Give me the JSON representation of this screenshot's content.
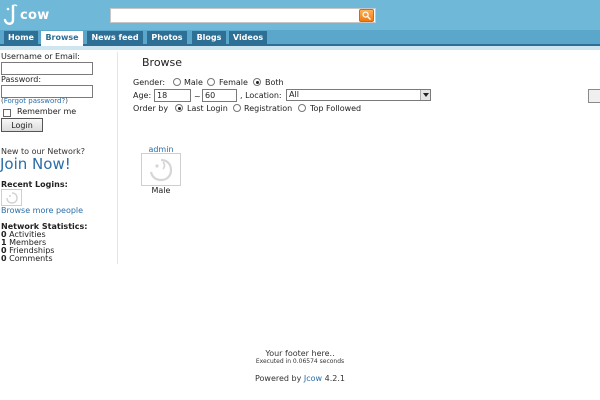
{
  "header": {
    "logo_text": "cow",
    "search": {
      "value": "",
      "placeholder": ""
    }
  },
  "nav": {
    "tabs": [
      {
        "label": "Home",
        "active": false
      },
      {
        "label": "Browse",
        "active": true
      },
      {
        "label": "News feed",
        "active": false
      },
      {
        "label": "Photos",
        "active": false
      },
      {
        "label": "Blogs",
        "active": false
      },
      {
        "label": "Videos",
        "active": false
      }
    ]
  },
  "sidebar": {
    "username_label": "Username or Email:",
    "password_label": "Password:",
    "forgot_prefix": "(",
    "forgot_link": "Forgot password?",
    "forgot_suffix": ")",
    "remember_label": "Remember me",
    "login_button": "Login",
    "new_network": "New to our Network?",
    "join_now": "Join Now!",
    "recent_logins": "Recent Logins:",
    "browse_more": "Browse more people",
    "stats_title": "Network Statistics:",
    "stats": [
      {
        "count": "0",
        "label": "Activities"
      },
      {
        "count": "1",
        "label": "Members"
      },
      {
        "count": "0",
        "label": "Friendships"
      },
      {
        "count": "0",
        "label": "Comments"
      }
    ]
  },
  "main": {
    "title": "Browse",
    "gender_label": "Gender:",
    "gender_options": [
      {
        "label": "Male",
        "checked": false
      },
      {
        "label": "Female",
        "checked": false
      },
      {
        "label": "Both",
        "checked": true
      }
    ],
    "age_label": "Age:",
    "age_from": "18",
    "age_sep": "~",
    "age_to": "60",
    "location_label": ", Location:",
    "location_value": "All",
    "order_label": "Order by",
    "order_options": [
      {
        "label": "Last Login",
        "checked": true
      },
      {
        "label": "Registration",
        "checked": false
      },
      {
        "label": "Top Followed",
        "checked": false
      }
    ],
    "members": [
      {
        "name": "admin",
        "gender": "Male"
      }
    ]
  },
  "footer": {
    "text": "Your footer here..",
    "executed": "Executed in 0.06574 seconds",
    "powered_prefix": "Powered by ",
    "powered_link": "Jcow",
    "version": " 4.2.1"
  },
  "colors": {
    "header_bg": "#6fb8d8",
    "nav_bg": "#5aa7cb",
    "tab_bg": "#2e6f95",
    "link": "#2a6ea8",
    "search_button": "#f07a0c"
  }
}
